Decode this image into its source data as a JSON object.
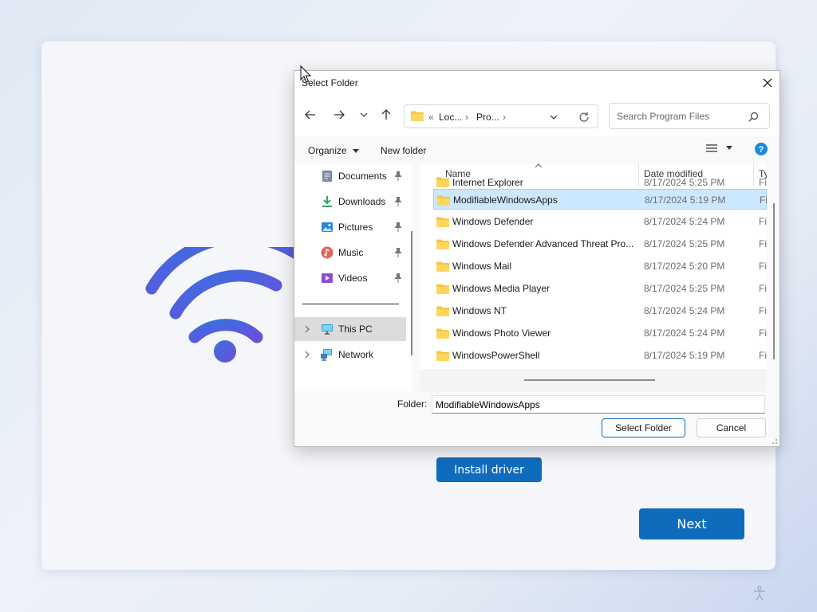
{
  "setup": {
    "install_driver_label": "Install driver",
    "next_label": "Next"
  },
  "dialog": {
    "title": "Select Folder",
    "nav": {
      "breadcrumb_prefix": "«",
      "crumbs": [
        "Loc...",
        "Pro..."
      ],
      "search_placeholder": "Search Program Files"
    },
    "toolbar": {
      "organize_label": "Organize",
      "new_folder_label": "New folder"
    },
    "nav_pane": [
      {
        "label": "Documents",
        "icon": "documents-icon",
        "pinned": true
      },
      {
        "label": "Downloads",
        "icon": "downloads-icon",
        "pinned": true
      },
      {
        "label": "Pictures",
        "icon": "pictures-icon",
        "pinned": true
      },
      {
        "label": "Music",
        "icon": "music-icon",
        "pinned": true
      },
      {
        "label": "Videos",
        "icon": "videos-icon",
        "pinned": true
      },
      {
        "label": "This PC",
        "icon": "this-pc-icon",
        "selected": true
      },
      {
        "label": "Network",
        "icon": "network-icon"
      }
    ],
    "columns": [
      "Name",
      "Date modified",
      "Ty"
    ],
    "files": [
      {
        "name": "Internet Explorer",
        "date": "8/17/2024 5:25 PM",
        "type": "Fi"
      },
      {
        "name": "ModifiableWindowsApps",
        "date": "8/17/2024 5:19 PM",
        "type": "Fi",
        "selected": true
      },
      {
        "name": "Windows Defender",
        "date": "8/17/2024 5:24 PM",
        "type": "Fi"
      },
      {
        "name": "Windows Defender Advanced Threat Pro...",
        "date": "8/17/2024 5:25 PM",
        "type": "Fi"
      },
      {
        "name": "Windows Mail",
        "date": "8/17/2024 5:20 PM",
        "type": "Fi"
      },
      {
        "name": "Windows Media Player",
        "date": "8/17/2024 5:25 PM",
        "type": "Fi"
      },
      {
        "name": "Windows NT",
        "date": "8/17/2024 5:24 PM",
        "type": "Fi"
      },
      {
        "name": "Windows Photo Viewer",
        "date": "8/17/2024 5:24 PM",
        "type": "Fi"
      },
      {
        "name": "WindowsPowerShell",
        "date": "8/17/2024 5:19 PM",
        "type": "Fi"
      }
    ],
    "folder_label": "Folder:",
    "folder_value": "ModifiableWindowsApps",
    "select_folder_label": "Select Folder",
    "cancel_label": "Cancel"
  },
  "colors": {
    "accent": "#0f6cbd",
    "wifi_gradient_start": "#3b6fe0",
    "wifi_gradient_end": "#6a4fd8",
    "folder": "#f5c542",
    "selection": "#cce8ff"
  }
}
